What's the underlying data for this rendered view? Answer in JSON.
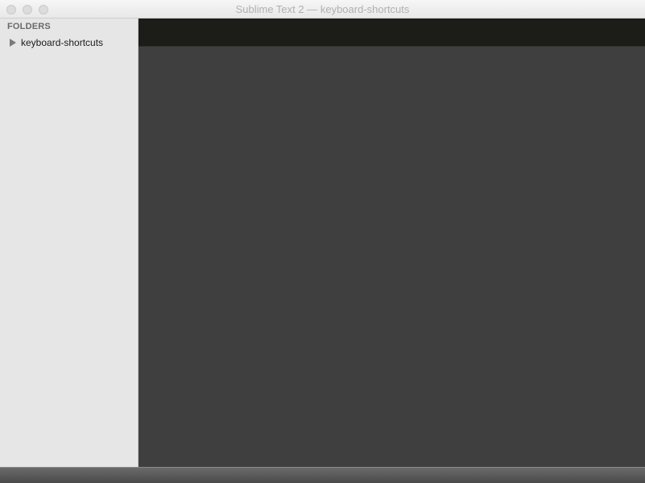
{
  "window": {
    "title": "Sublime Text 2 — keyboard-shortcuts"
  },
  "sidebar": {
    "header": "FOLDERS",
    "items": [
      {
        "label": "keyboard-shortcuts",
        "icon": "disclosure-triangle-right-icon"
      }
    ]
  },
  "colors": {
    "tabbar": "#1c1c18",
    "editor_background": "#3f3f3f",
    "sidebar_background": "#e6e6e6",
    "statusbar": "#555555"
  }
}
